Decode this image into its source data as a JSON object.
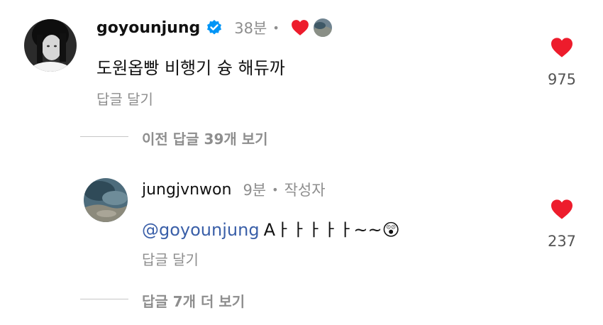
{
  "comments": [
    {
      "username": "goyounjung",
      "time": "38분",
      "text": "도원옵빵 비행기 슝 해듀까",
      "reply_label": "답글 달기",
      "like_count": "975"
    },
    {
      "username": "jungjvnwon",
      "time": "9분",
      "badge": "작성자",
      "mention": "@goyounjung",
      "text": "Aㅏㅏㅏㅏㅏ~~",
      "emoji": "😲",
      "reply_label": "답글 달기",
      "like_count": "237"
    }
  ],
  "threads": {
    "previous_replies": "이전 답글 39개 보기",
    "more_replies": "답글 7개 더 보기"
  },
  "colors": {
    "heart": "#ed4956",
    "verified": "#0095f6",
    "mention": "#3a5fa8",
    "muted": "#8e8e8e"
  },
  "icons": [
    "verified-badge-icon",
    "heart-icon",
    "like-heart-icon"
  ]
}
